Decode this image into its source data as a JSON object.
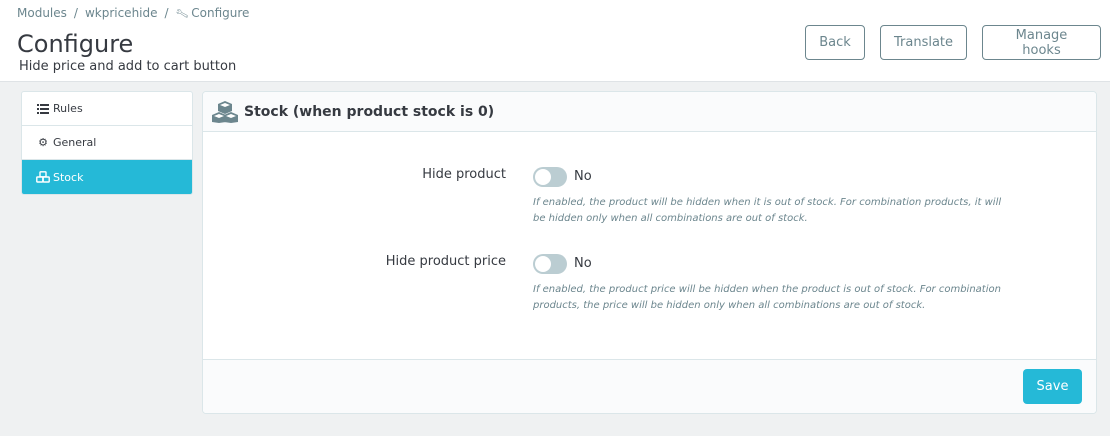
{
  "breadcrumb": {
    "items": [
      "Modules",
      "wkpricehide",
      "Configure"
    ],
    "separator": "/"
  },
  "header": {
    "title": "Configure",
    "subtitle": "Hide price and add to cart button",
    "buttons": {
      "back": "Back",
      "translate": "Translate",
      "manage_hooks": "Manage hooks"
    }
  },
  "sidebar": {
    "items": [
      {
        "label": "Rules",
        "icon": "list-icon",
        "active": false
      },
      {
        "label": "General",
        "icon": "gear-icon",
        "active": false
      },
      {
        "label": "Stock",
        "icon": "cubes-icon",
        "active": true
      }
    ]
  },
  "panel": {
    "title": "Stock (when product stock is 0)",
    "icon": "cubes-icon",
    "fields": [
      {
        "label": "Hide product",
        "value": "No",
        "enabled": false,
        "help": "If enabled, the product will be hidden when it is out of stock. For combination products, it will be hidden only when all combinations are out of stock."
      },
      {
        "label": "Hide product price",
        "value": "No",
        "enabled": false,
        "help": "If enabled, the product price will be hidden when the product is out of stock. For combination products, the price will be hidden only when all combinations are out of stock."
      }
    ],
    "save_label": "Save"
  },
  "colors": {
    "accent": "#25b9d7",
    "switch_off": "#bbcdd2",
    "muted_text": "#6c868e",
    "background": "#eff1f2"
  }
}
